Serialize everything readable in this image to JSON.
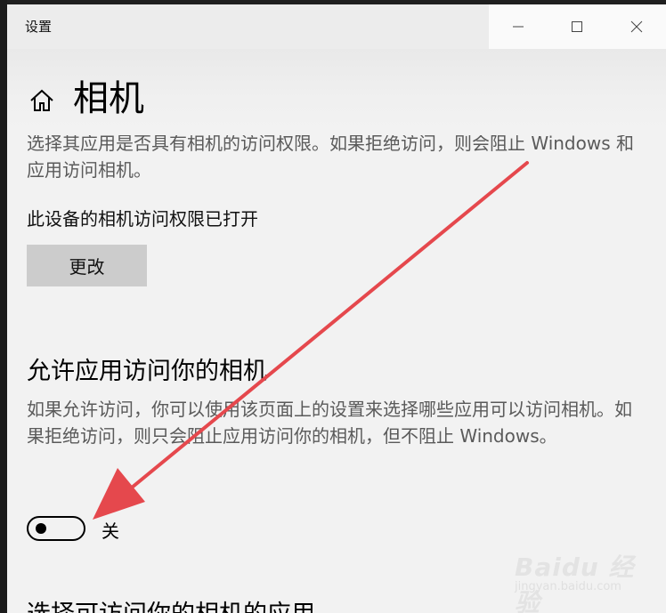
{
  "window": {
    "title": "设置",
    "caption_buttons": [
      "minimize-icon",
      "maximize-icon",
      "close-icon"
    ]
  },
  "header": {
    "home_icon": "home-icon",
    "title": "相机"
  },
  "camera_access": {
    "description": "选择其应用是否具有相机的访问权限。如果拒绝访问，则会阻止 Windows 和应用访问相机。",
    "status": "此设备的相机访问权限已打开",
    "change_button": "更改"
  },
  "allow_apps": {
    "heading": "允许应用访问你的相机",
    "description": "如果允许访问，你可以使用该页面上的设置来选择哪些应用可以访问相机。如果拒绝访问，则只会阻止应用访问你的相机，但不阻止 Windows。",
    "toggle_state": "off",
    "toggle_label": "关"
  },
  "next_section": {
    "heading": "选择可访问你的相机的应用"
  },
  "annotation": {
    "arrow_color": "#e5484d"
  },
  "watermark": {
    "brand": "Baidu 经验",
    "site": "jingyan.baidu.com"
  },
  "colors": {
    "background": "#f2f2f2",
    "button_bg": "#cccccc",
    "description_text": "#5a5a5a"
  }
}
